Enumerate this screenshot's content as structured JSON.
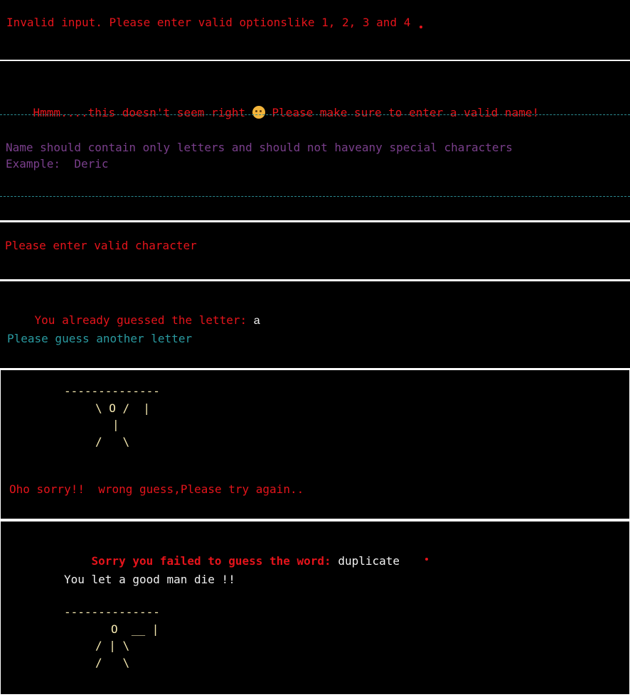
{
  "panel1": {
    "message": "Invalid input. Please enter valid optionslike 1, 2, 3 and 4"
  },
  "panel2": {
    "message_before": "Hmmm....this doesn't seem right ",
    "emoji_icon": "thinking-face-icon",
    "message_after": " Please make sure to enter a valid name!",
    "rule": "Name should contain only letters and should not haveany special characters",
    "example": "Example:  Deric"
  },
  "panel3": {
    "message": "Please enter valid character"
  },
  "panel4": {
    "already_label": "You already guessed the letter: ",
    "letter": "a",
    "prompt": "Please guess another letter"
  },
  "panel5": {
    "gallows_top": "--------------",
    "figure_line1": "\\ O /  |",
    "figure_line2": "|",
    "figure_line3": "/   \\",
    "message": "Oho sorry!!  wrong guess,Please try again.."
  },
  "panel6": {
    "fail_label": "Sorry you failed to guess the word:",
    "word": "duplicate",
    "die_message": "You let a good man die !!",
    "gallows_top": "--------------",
    "figure_line1": "O  __ |",
    "figure_line2": "/ | \\",
    "figure_line3": "/   \\"
  },
  "colors": {
    "error_red": "#e5141b",
    "info_purple": "#7a3f8c",
    "teal": "#2a9aa0",
    "white": "#f2f2f2",
    "ascii_yellow": "#f5e9b0",
    "background": "#000000"
  }
}
